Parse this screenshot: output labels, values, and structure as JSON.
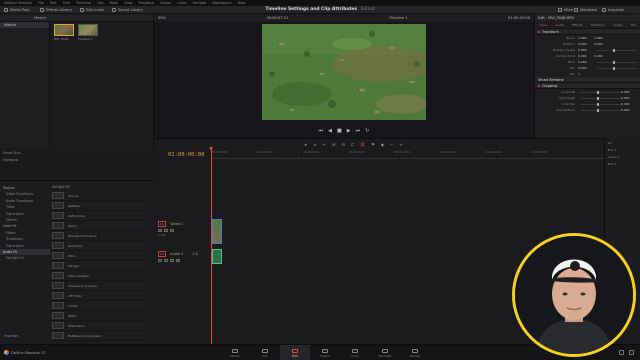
{
  "menubar": [
    "DaVinci Resolve",
    "File",
    "Edit",
    "Trim",
    "Timeline",
    "Clip",
    "Mark",
    "View",
    "Playback",
    "Fusion",
    "Color",
    "Fairlight",
    "Workspace",
    "Help"
  ],
  "toolbar": {
    "media_pool": "Media Pool",
    "effects_library": "Effects Library",
    "edit_index": "Edit Index",
    "sound_library": "Sound Library",
    "title": "Timeline Settings and Clip Attributes",
    "title_status": "Edited",
    "mixer": "Mixer",
    "metadata": "Metadata",
    "inspector": "Inspector"
  },
  "media_pool": {
    "header": "Master",
    "bins": [
      "Master"
    ],
    "clips": [
      {
        "name": "MVI_3548...",
        "selected": true
      },
      {
        "name": "Timeline 1",
        "selected": false
      }
    ],
    "smart_bins_header": "Smart Bins",
    "smart_bins": [
      "Keywords"
    ]
  },
  "viewer": {
    "zoom": "59%",
    "source_timecode": "00:00:07:11",
    "timeline_name": "Timeline 1",
    "record_timecode": "01:00:00:00"
  },
  "inspector": {
    "clip_name": "Edit - MVI_3548.MP4",
    "tabs": [
      "Video",
      "Audio",
      "Effects",
      "Transition",
      "Image",
      "File"
    ],
    "sections": {
      "transform": "Transform",
      "smart_reframe": "Smart Reframe",
      "cropping": "Cropping"
    },
    "transform_props": [
      {
        "label": "Zoom",
        "x": "1.000",
        "y": "1.000"
      },
      {
        "label": "Position",
        "x": "0.000",
        "y": "0.000"
      },
      {
        "label": "Rotation Angle",
        "x": "0.000",
        "y": ""
      },
      {
        "label": "Anchor Point",
        "x": "0.000",
        "y": "0.000"
      },
      {
        "label": "Pitch",
        "x": "0.000",
        "y": ""
      },
      {
        "label": "Yaw",
        "x": "0.000",
        "y": ""
      },
      {
        "label": "Flip",
        "x": "",
        "y": ""
      }
    ],
    "crop_props": [
      {
        "label": "Crop Left",
        "x": "0.000"
      },
      {
        "label": "Crop Right",
        "x": "0.000"
      },
      {
        "label": "Crop Top",
        "x": "0.000"
      },
      {
        "label": "Crop Bottom",
        "x": "0.000"
      }
    ]
  },
  "effects": {
    "tree": [
      {
        "label": "Toolbox",
        "level": "top",
        "selected": false
      },
      {
        "label": "Video Transitions",
        "level": "sub",
        "selected": false
      },
      {
        "label": "Audio Transitions",
        "level": "sub",
        "selected": false
      },
      {
        "label": "Titles",
        "level": "sub",
        "selected": false
      },
      {
        "label": "Generators",
        "level": "sub",
        "selected": false
      },
      {
        "label": "Effects",
        "level": "sub",
        "selected": false
      },
      {
        "label": "Open FX",
        "level": "top",
        "selected": false
      },
      {
        "label": "Filters",
        "level": "sub",
        "selected": false
      },
      {
        "label": "Transitions",
        "level": "sub",
        "selected": false
      },
      {
        "label": "Generators",
        "level": "sub",
        "selected": false
      },
      {
        "label": "Audio FX",
        "level": "top",
        "selected": true
      },
      {
        "label": "Fairlight FX",
        "level": "sub",
        "selected": false
      }
    ],
    "list_header": "Fairlight FX",
    "items": [
      "Chorus",
      "DeEsser",
      "DeHummer",
      "Delay",
      "Dialogue Processor",
      "Distortion",
      "Echo",
      "Flanger",
      "Foley Sampler",
      "Frequency Analyzer",
      "LFE Filter",
      "Limiter",
      "Meter",
      "Modulation",
      "Multiband Compressor"
    ],
    "favorites": "Favorites"
  },
  "timeline": {
    "timecode": "01:00:00:00",
    "ruler_ticks": [
      "01:00:00:00",
      "01:00:04:00",
      "01:00:08:00",
      "01:00:12:00",
      "01:00:16:00",
      "01:00:20:00",
      "01:00:24:00",
      "01:00:28:00"
    ],
    "video_track": {
      "badge": "V1",
      "name": "Video 1",
      "clip_count": "1 Clip"
    },
    "audio_track": {
      "badge": "A1",
      "name": "Audio 1",
      "level": "2.0"
    }
  },
  "mixer": {
    "channels": [
      "A1",
      "Bus 1"
    ],
    "audio_label": "Audio 1",
    "bus_label": "Bus 1"
  },
  "pagebar": {
    "brand": "DaVinci Resolve 17",
    "pages": [
      "Media",
      "Cut",
      "Edit",
      "Fusion",
      "Color",
      "Fairlight",
      "Deliver"
    ],
    "active_page": "Edit"
  },
  "colors": {
    "accent": "#e04848",
    "timecode": "#e8a23c",
    "webcam_ring": "#f5d21e"
  }
}
